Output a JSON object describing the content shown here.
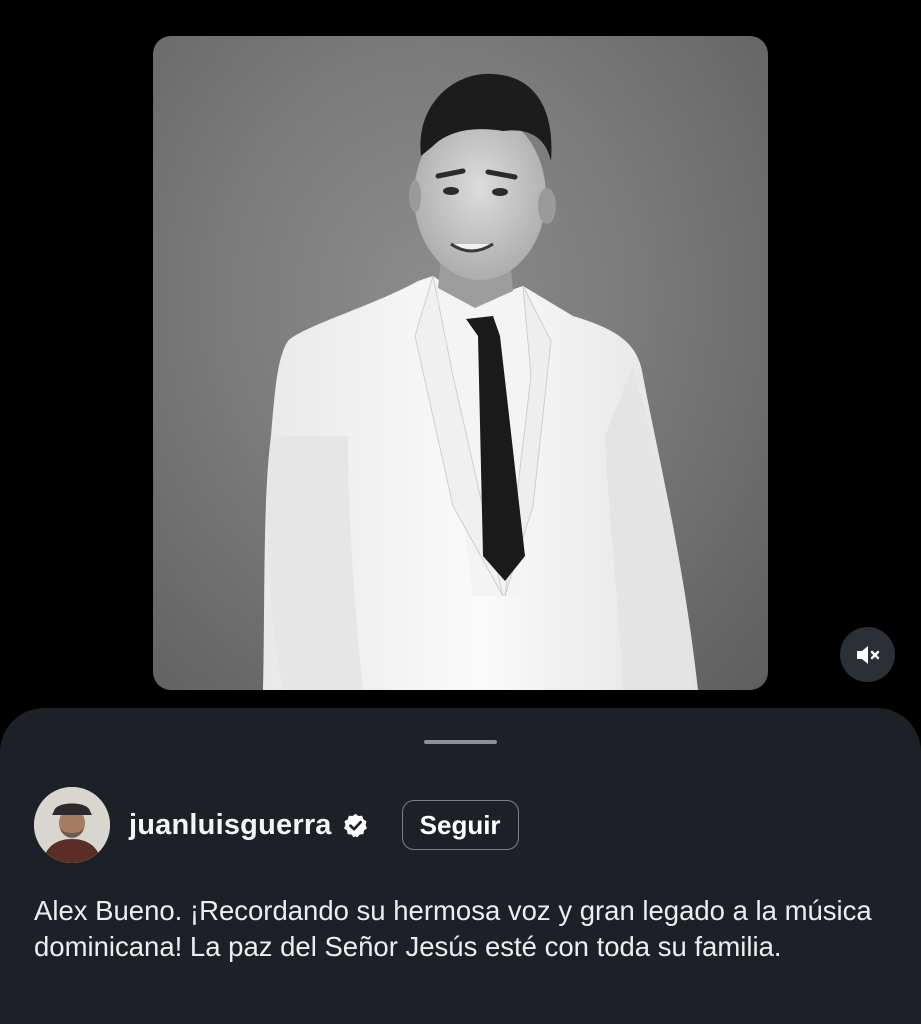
{
  "media": {
    "image_description": "",
    "mute_icon": "speaker-muted-icon"
  },
  "sheet": {
    "author": {
      "username": "juanluisguerra",
      "verified_icon": "verified-badge-icon",
      "follow_label": "Seguir"
    },
    "caption": "Alex Bueno. ¡Recordando su hermosa voz y gran legado a la música dominicana! La paz del Señor Jesús esté con toda su familia."
  },
  "colors": {
    "background": "#000000",
    "sheet": "#1d2127",
    "button_border": "#7b7f86",
    "mute_button": "#2b2f36"
  }
}
